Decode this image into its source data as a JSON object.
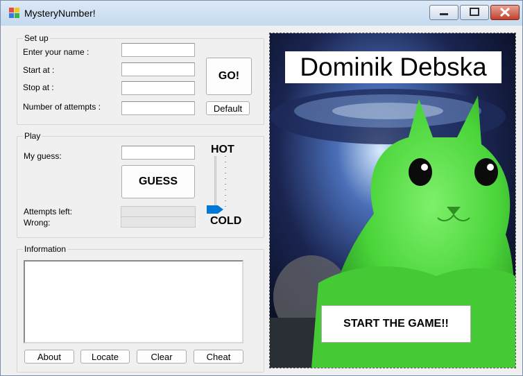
{
  "window": {
    "title": "MysteryNumber!"
  },
  "setup": {
    "group_label": "Set up",
    "name_label": "Enter your name :",
    "name_value": "",
    "start_label": "Start at :",
    "start_value": "",
    "stop_label": "Stop at :",
    "stop_value": "",
    "attempts_label": "Number of attempts :",
    "attempts_value": "",
    "go_label": "GO!",
    "default_label": "Default"
  },
  "play": {
    "group_label": "Play",
    "guess_label": "My guess:",
    "guess_value": "",
    "guess_button": "GUESS",
    "attempts_left_label": "Attempts left:",
    "attempts_left_value": "",
    "wrong_label": "Wrong:",
    "wrong_value": "",
    "hot_label": "HOT",
    "cold_label": "COLD",
    "temperature_level": 0
  },
  "information": {
    "group_label": "Information",
    "text": "",
    "about_label": "About",
    "locate_label": "Locate",
    "clear_label": "Clear",
    "cheat_label": "Cheat"
  },
  "picture": {
    "player_name": "Dominik Debska",
    "start_button": "START THE GAME!!"
  },
  "colors": {
    "accent": "#0078d7",
    "cat_green": "#4ad43a",
    "space_dark": "#0d1430",
    "close_red": "#c2412c"
  }
}
